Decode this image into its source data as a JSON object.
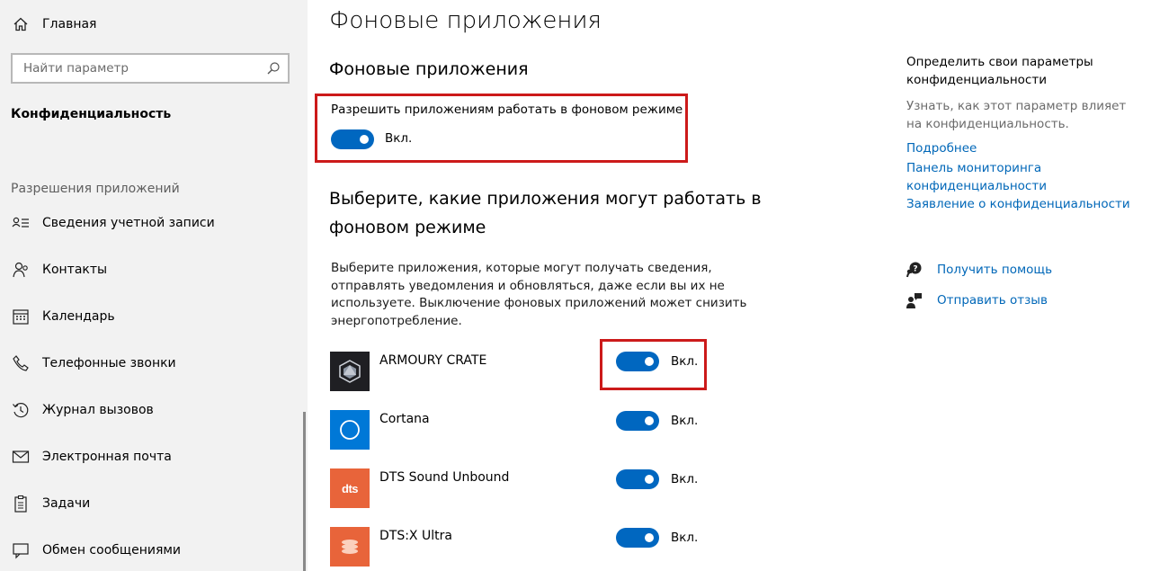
{
  "sidebar": {
    "home_label": "Главная",
    "search_placeholder": "Найти параметр",
    "section_title": "Конфиденциальность",
    "group_title": "Разрешения приложений",
    "items": [
      {
        "label": "Сведения учетной записи",
        "icon": "account-info-icon"
      },
      {
        "label": "Контакты",
        "icon": "contacts-icon"
      },
      {
        "label": "Календарь",
        "icon": "calendar-icon"
      },
      {
        "label": "Телефонные звонки",
        "icon": "phone-icon"
      },
      {
        "label": "Журнал вызовов",
        "icon": "call-history-icon"
      },
      {
        "label": "Электронная почта",
        "icon": "mail-icon"
      },
      {
        "label": "Задачи",
        "icon": "tasks-icon"
      },
      {
        "label": "Обмен сообщениями",
        "icon": "messaging-icon"
      }
    ]
  },
  "main": {
    "page_title": "Фоновые приложения",
    "section_title": "Фоновые приложения",
    "allow_label": "Разрешить приложениям работать в фоновом режиме",
    "allow_state": "Вкл.",
    "choose_title": "Выберите, какие приложения могут работать в фоновом режиме",
    "description": "Выберите приложения, которые могут получать сведения, отправлять уведомления и обновляться, даже если вы их не используете. Выключение фоновых приложений может снизить энергопотребление.",
    "apps": [
      {
        "name": "ARMOURY CRATE",
        "state": "Вкл.",
        "icon_color": "#1f1f23"
      },
      {
        "name": "Cortana",
        "state": "Вкл.",
        "icon_color": "#0078d7"
      },
      {
        "name": "DTS Sound Unbound",
        "state": "Вкл.",
        "icon_color": "#e8643a"
      },
      {
        "name": "DTS:X Ultra",
        "state": "Вкл.",
        "icon_color": "#e8643a"
      }
    ],
    "dts_logo_text": "dts"
  },
  "right": {
    "title": "Определить свои параметры конфиденциальности",
    "muted": "Узнать, как этот параметр влияет на конфиденциальность.",
    "links": [
      "Подробнее",
      "Панель мониторинга конфиденциальности",
      "Заявление о конфиденциальности"
    ],
    "help_label": "Получить помощь",
    "feedback_label": "Отправить отзыв"
  },
  "colors": {
    "accent": "#0067c0",
    "link": "#0067b8",
    "highlight": "#cc1a1a",
    "sidebar_bg": "#f2f2f2"
  }
}
